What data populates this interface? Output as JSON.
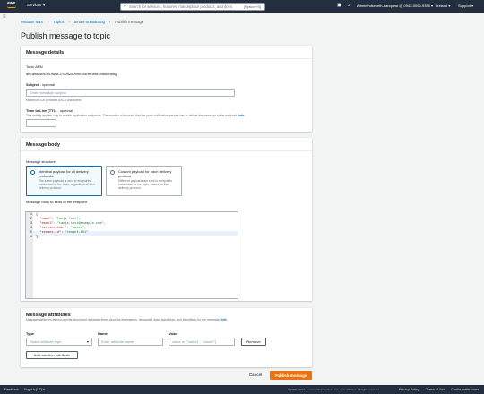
{
  "topnav": {
    "logo_text": "aws",
    "services_label": "Services",
    "search_placeholder": "Search for services, features, marketplace products, and docs",
    "search_shortcut": "[Option+S]",
    "account_label": "Admin/mikeketh-banquest @ 0942-0099-9356",
    "region_label": "Ireland",
    "support_label": "Support"
  },
  "breadcrumb": {
    "items": [
      "Amazon SNS",
      "Topics",
      "tenant-onboarding"
    ],
    "current": "Publish message"
  },
  "page_title": "Publish message to topic",
  "details": {
    "heading": "Message details",
    "topic_arn_label": "Topic ARN",
    "topic_arn_value": "arn:aws:sns:eu-west-1:094200999356:tenant-onboarding",
    "subject_label": "Subject",
    "subject_optional": "- optional",
    "subject_placeholder": "Enter message subject",
    "subject_hint": "Maximum 100 printable ASCII characters",
    "ttl_label": "Time to Live (TTL)",
    "ttl_optional": "- optional",
    "ttl_hint": "This setting applies only to mobile application endpoints. The number of seconds that the push notification service has to deliver the message to the endpoint.",
    "info_label": "Info"
  },
  "body": {
    "heading": "Message body",
    "structure_label": "Message structure",
    "option1_title": "Identical payload for all delivery protocols.",
    "option1_desc": "The same payload is sent to endpoints subscribed to the topic, regardless of their delivery protocol.",
    "option2_title": "Custom payload for each delivery protocol.",
    "option2_desc": "Different payloads are sent to endpoints subscribed to the topic, based on their delivery protocol.",
    "editor_label": "Message body to send to the endpoint",
    "code_lines": [
      {
        "n": "1",
        "text": "{"
      },
      {
        "n": "2",
        "key": "\"name\"",
        "val": "\"Tanja Test\","
      },
      {
        "n": "3",
        "key": "\"email\"",
        "val": "\"tanja.test@example.com\","
      },
      {
        "n": "4",
        "key": "\"service-tier\"",
        "val": "\"basic\","
      },
      {
        "n": "5",
        "key": "\"tenant-id\"",
        "val": "\"tenant-001\""
      },
      {
        "n": "6",
        "text": "}"
      }
    ]
  },
  "attributes": {
    "heading": "Message attributes",
    "hint": "Message attributes let you provide structured metadata items (such as timestamps, geospatial data, signatures, and identifiers) for the message.",
    "info_label": "Info",
    "type_label": "Type",
    "type_placeholder": "Select attribute type",
    "name_label": "Name",
    "name_placeholder": "Enter attribute name",
    "value_label": "Value",
    "value_placeholder": "value or [\"value1\", \"value2\"]",
    "remove_label": "Remove",
    "add_label": "Add another attribute"
  },
  "actions": {
    "cancel_label": "Cancel",
    "publish_label": "Publish message"
  },
  "footer": {
    "feedback": "Feedback",
    "language": "English (US)",
    "copyright": "© 2008 - 2021, Amazon Web Services, Inc. or its affiliates. All rights reserved.",
    "privacy": "Privacy Policy",
    "terms": "Terms of Use",
    "cookies": "Cookie preferences"
  },
  "colors": {
    "nav_bg": "#232f3e",
    "accent": "#ec7211",
    "link": "#0073bb",
    "selected_border": "#0073bb"
  }
}
